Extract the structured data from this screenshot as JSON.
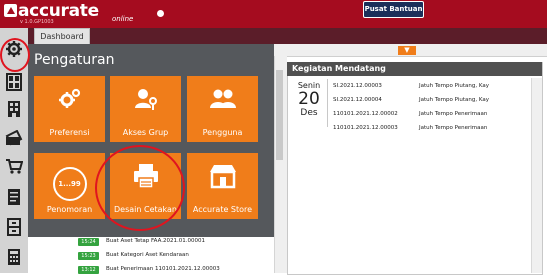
{
  "app": {
    "logo": "accurate",
    "logo_sub": "online",
    "version": "v 1.0.GP1003",
    "help_button": "Pusat Bantuan"
  },
  "tabs": [
    {
      "label": "Dashboard"
    }
  ],
  "sidebar": {
    "icons": [
      "gear-icon",
      "grid-icon",
      "building-icon",
      "card-icon",
      "cart-icon",
      "document-icon",
      "cabinet-icon",
      "calculator-icon"
    ]
  },
  "settings": {
    "title": "Pengaturan",
    "tiles": [
      {
        "label": "Preferensi",
        "icon": "gears-icon"
      },
      {
        "label": "Akses Grup",
        "icon": "user-key-icon"
      },
      {
        "label": "Pengguna",
        "icon": "users-icon"
      },
      {
        "label": "Penomoran",
        "icon": "numbering-icon",
        "glyph": "1...99"
      },
      {
        "label": "Desain Cetakan",
        "icon": "printer-icon"
      },
      {
        "label": "Accurate Store",
        "icon": "store-icon"
      }
    ]
  },
  "agenda": {
    "title": "Kegiatan Mendatang",
    "date": {
      "day": "Senin",
      "num": "20",
      "month": "Des"
    },
    "events": [
      {
        "ref": "SI.2021.12.00003",
        "desc": "Jatuh Tempo Piutang, Kay"
      },
      {
        "ref": "SI.2021.12.00004",
        "desc": "Jatuh Tempo Piutang, Kay"
      },
      {
        "ref": "110101.2021.12.00002",
        "desc": "Jatuh Tempo Penerimaan"
      },
      {
        "ref": "110101.2021.12.00003",
        "desc": "Jatuh Tempo Penerimaan"
      }
    ]
  },
  "activity": [
    {
      "time": "15:24",
      "text": "Buat Aset Tetap FAA.2021.01.00001"
    },
    {
      "time": "15:23",
      "text": "Buat Kategori Aset Kendaraan"
    },
    {
      "time": "13:12",
      "text": "Buat Penerimaan 110101.2021.12.00003"
    }
  ],
  "colors": {
    "brand": "#a50c1f",
    "tile": "#f07d1a",
    "panel": "#55585c",
    "annotation": "#e0141f"
  }
}
